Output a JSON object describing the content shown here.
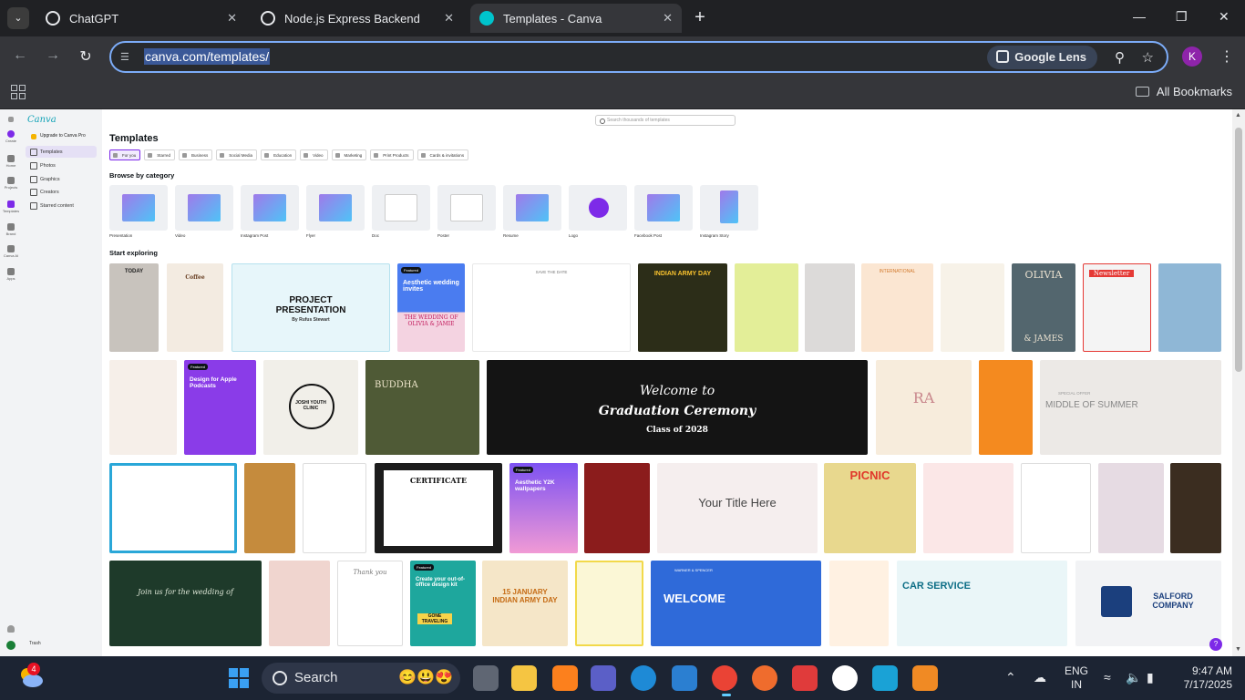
{
  "tabs": [
    {
      "label": "ChatGPT",
      "color": "#e8eaed"
    },
    {
      "label": "Node.js Express Backend",
      "color": "#e8eaed"
    },
    {
      "label": "Templates - Canva",
      "color": "#00c4cc"
    }
  ],
  "omnibox": {
    "url": "canva.com/templates/",
    "lens_label": "Google Lens"
  },
  "profile": {
    "initial": "K"
  },
  "bookmarks": {
    "all_label": "All Bookmarks"
  },
  "rail": [
    "Create",
    "Home",
    "Projects",
    "Templates",
    "Brand",
    "Canva AI",
    "Apps"
  ],
  "nav": {
    "logo": "Canva",
    "upgrade": "Upgrade to Canva Pro",
    "items": [
      "Templates",
      "Photos",
      "Graphics",
      "Creators",
      "Starred content"
    ],
    "trash": "Trash"
  },
  "main": {
    "search_placeholder": "Search thousands of templates",
    "title": "Templates",
    "chips": [
      "For you",
      "Starred",
      "Business",
      "Social Media",
      "Education",
      "Video",
      "Marketing",
      "Print Products",
      "Cards & invitations"
    ],
    "browse_heading": "Browse by category",
    "categories": [
      "Presentation",
      "Video",
      "Instagram Post",
      "Flyer",
      "Doc",
      "Poster",
      "Resume",
      "Logo",
      "Facebook Post",
      "Instagram Story"
    ],
    "explore_heading": "Start exploring",
    "tiles": {
      "today": "TODAY",
      "coffee": "Coffee",
      "project": "PROJECT PRESENTATION",
      "project_by": "By Rufus Stewart",
      "wedding_title": "Aesthetic wedding invites",
      "wedding_names": "THE WEDDING OF OLIVIA & JAMIE",
      "save_date": "SAVE THE DATE",
      "army": "INDIAN ARMY DAY",
      "intl": "INTERNATIONAL",
      "olivia": "OLIVIA",
      "james": "& JAMES",
      "newsletter": "Newsletter",
      "apple": "Design for Apple Podcasts",
      "joshi": "JOSHI YOUTH CLINIC",
      "buddha": "BUDDHA",
      "grad_welcome": "Welcome to",
      "grad_title": "Graduation Ceremony",
      "grad_class": "Class of 2028",
      "ra": "RA",
      "summer_special": "SPECIAL OFFER",
      "summer": "MIDDLE OF SUMMER",
      "certificate": "CERTIFICATE",
      "y2k": "Aesthetic Y2K wallpapers",
      "your_title": "Your Title Here",
      "picnic": "PICNIC",
      "join": "Join us for the wedding of",
      "thank": "Thank you",
      "ooo": "Create your out-of-office design kit",
      "gone": "GONE TRAVELING",
      "army2": "15 JANUARY INDIAN ARMY DAY",
      "welcome": "WELCOME",
      "welcome_brand": "WARNER & SPENCER",
      "car": "CAR SERVICE",
      "salford": "SALFORD COMPANY",
      "featured": "Featured"
    }
  },
  "taskbar": {
    "weather_badge": "4",
    "search_label": "Search",
    "lang_1": "ENG",
    "lang_2": "IN",
    "time": "9:47 AM",
    "date": "7/17/2025"
  }
}
